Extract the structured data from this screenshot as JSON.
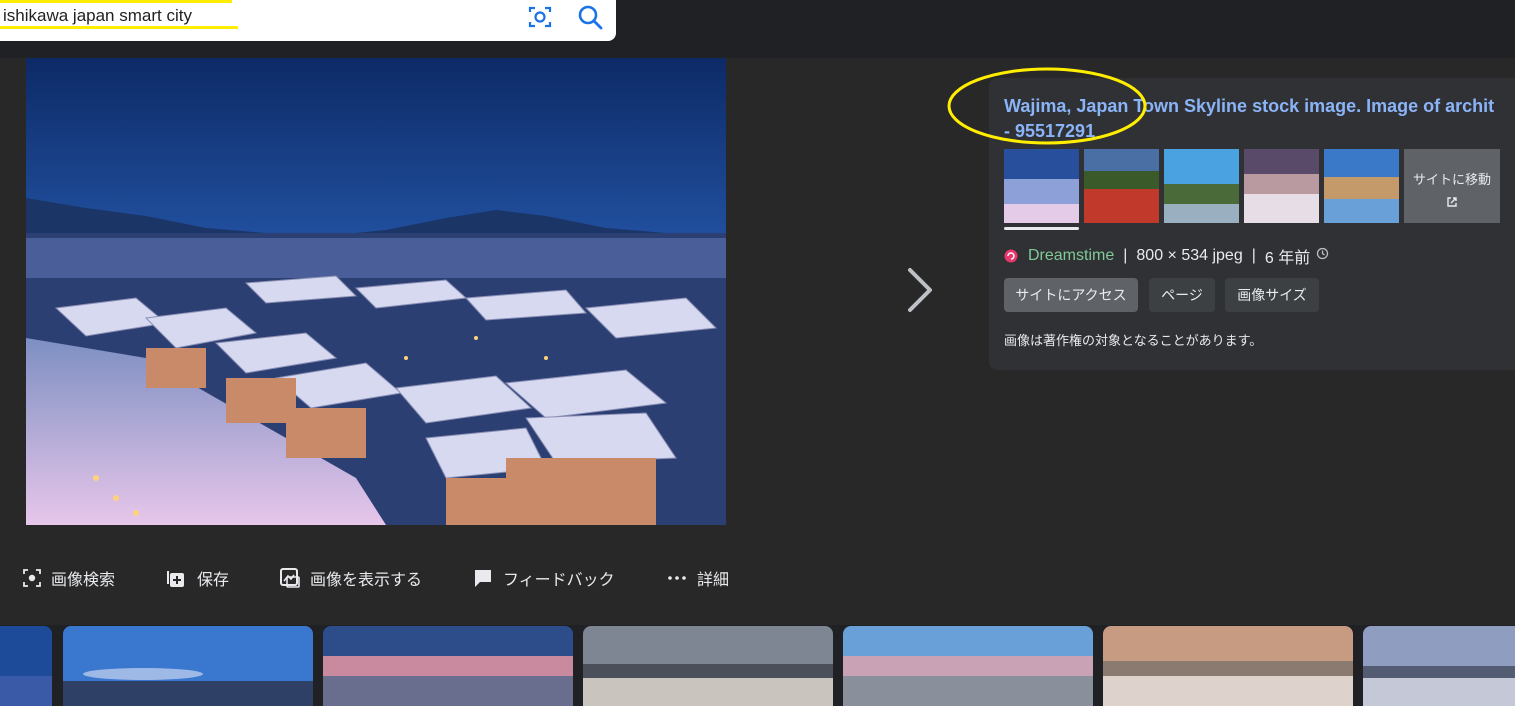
{
  "search": {
    "query": "ishikawa japan smart city",
    "lens_icon": "camera-lens-icon",
    "search_icon": "search-icon"
  },
  "main_image": {
    "description_icon": "photo",
    "next_icon": "chevron-right-icon"
  },
  "detail": {
    "title_line1": "Wajima, Japan Town Skyline stock image. Image of archit",
    "title_line2": "- 95517291",
    "goto_label": "サイトに移動",
    "goto_icon": "external-link-icon",
    "site": "Dreamstime",
    "dimensions": "800 × 534 jpeg",
    "age": "6 年前",
    "age_icon": "history-icon",
    "chips": [
      "サイトにアクセス",
      "ページ",
      "画像サイズ"
    ],
    "copyright_notice": "画像は著作権の対象となることがあります。"
  },
  "actions": [
    {
      "label": "画像検索",
      "icon": "lens-icon"
    },
    {
      "label": "保存",
      "icon": "save-add-icon"
    },
    {
      "label": "画像を表示する",
      "icon": "image-open-icon"
    },
    {
      "label": "フィードバック",
      "icon": "feedback-icon"
    },
    {
      "label": "詳細",
      "icon": "more-dots-icon"
    }
  ],
  "colors": {
    "background": "#202124",
    "panel": "#282828",
    "card": "#303134",
    "link": "#8ab4f8",
    "site_green": "#81c995",
    "highlight": "#ffee00"
  }
}
